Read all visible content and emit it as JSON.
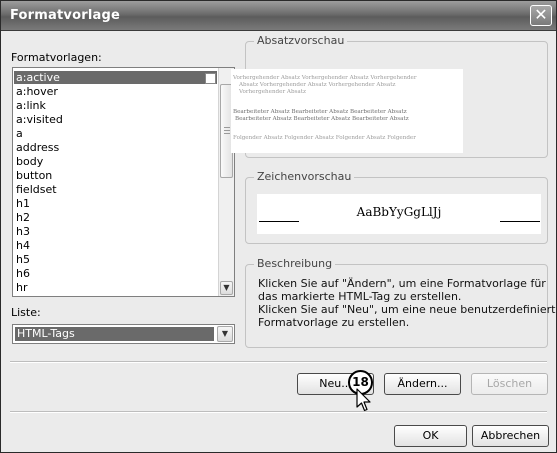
{
  "window": {
    "title": "Formatvorlage"
  },
  "left": {
    "styles_label": "Formatvorlagen:",
    "styles": [
      "a:active",
      "a:hover",
      "a:link",
      "a:visited",
      "a",
      "address",
      "body",
      "button",
      "fieldset",
      "h1",
      "h2",
      "h3",
      "h4",
      "h5",
      "h6",
      "hr"
    ],
    "selected_index": 0,
    "list_label": "Liste:",
    "list_value": "HTML-Tags"
  },
  "absatz": {
    "title": "Absatzvorschau",
    "lines": [
      "Vorhergehender Absatz Vorhergehender Absatz Vorhergehender",
      "Absatz Vorhergehender Absatz Vorhergehender Absatz",
      "Vorhergehender Absatz",
      "Bearbeiteter Absatz Bearbeiteter Absatz Bearbeiteter Absatz",
      "Bearbeiteter Absatz Bearbeiteter Absatz Bearbeiteter Absatz",
      "Folgender Absatz Folgender Absatz Folgender Absatz Folgender"
    ]
  },
  "zeichen": {
    "title": "Zeichenvorschau",
    "sample": "AaBbYyGgLlJj"
  },
  "beschreibung": {
    "title": "Beschreibung",
    "lines": [
      "Klicken Sie auf \"Ändern\", um eine Formatvorlage für",
      "das markierte HTML-Tag zu erstellen.",
      "Klicken Sie auf \"Neu\", um eine neue benutzerdefinierte",
      "Formatvorlage zu erstellen."
    ]
  },
  "buttons": {
    "neu": "Neu...",
    "aendern": "Ändern...",
    "loeschen": "Löschen",
    "ok": "OK",
    "abbrechen": "Abbrechen"
  },
  "step_badge": "18",
  "colors": {
    "titlebar": "#6c6c6c",
    "selection": "#6a6a6a",
    "dialog_bg": "#ebebeb"
  }
}
